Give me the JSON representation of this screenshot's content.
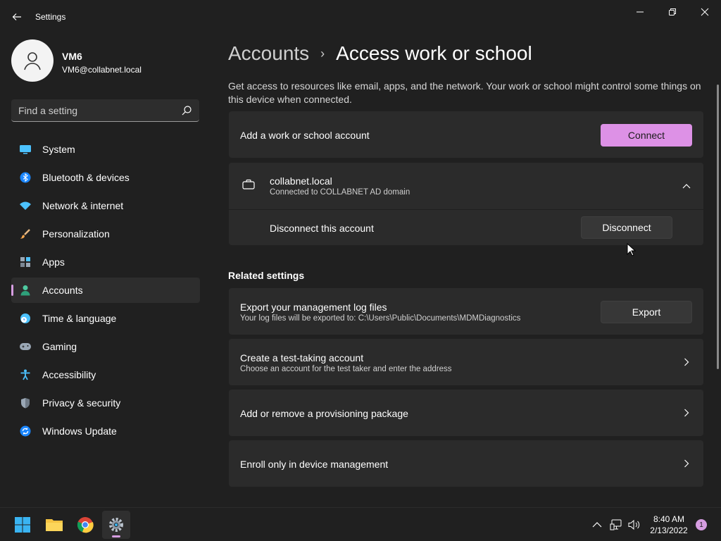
{
  "window": {
    "title": "Settings"
  },
  "profile": {
    "name": "VM6",
    "email": "VM6@collabnet.local"
  },
  "search": {
    "placeholder": "Find a setting"
  },
  "sidebar": {
    "items": [
      {
        "label": "System",
        "icon": "monitor-icon"
      },
      {
        "label": "Bluetooth & devices",
        "icon": "bluetooth-icon"
      },
      {
        "label": "Network & internet",
        "icon": "wifi-icon"
      },
      {
        "label": "Personalization",
        "icon": "paintbrush-icon"
      },
      {
        "label": "Apps",
        "icon": "apps-icon"
      },
      {
        "label": "Accounts",
        "icon": "person-icon",
        "active": true
      },
      {
        "label": "Time & language",
        "icon": "globe-clock-icon"
      },
      {
        "label": "Gaming",
        "icon": "gamepad-icon"
      },
      {
        "label": "Accessibility",
        "icon": "accessibility-icon"
      },
      {
        "label": "Privacy & security",
        "icon": "shield-icon"
      },
      {
        "label": "Windows Update",
        "icon": "update-icon"
      }
    ]
  },
  "header": {
    "parent": "Accounts",
    "separator": "›",
    "current": "Access work or school"
  },
  "description": "Get access to resources like email, apps, and the network. Your work or school might control some things on this device when connected.",
  "add_account": {
    "label": "Add a work or school account",
    "button": "Connect"
  },
  "connected_account": {
    "domain": "collabnet.local",
    "status": "Connected to COLLABNET AD domain",
    "disconnect_label": "Disconnect this account",
    "disconnect_button": "Disconnect"
  },
  "related": {
    "title": "Related settings",
    "items": [
      {
        "title": "Export your management log files",
        "subtitle": "Your log files will be exported to: C:\\Users\\Public\\Documents\\MDMDiagnostics",
        "button": "Export"
      },
      {
        "title": "Create a test-taking account",
        "subtitle": "Choose an account for the test taker and enter the address"
      },
      {
        "title": "Add or remove a provisioning package"
      },
      {
        "title": "Enroll only in device management"
      }
    ]
  },
  "taskbar": {
    "time": "8:40 AM",
    "date": "2/13/2022",
    "notifications": "1"
  },
  "colors": {
    "accent": "#dd91e6",
    "background": "#202020",
    "card": "#2b2b2b"
  }
}
